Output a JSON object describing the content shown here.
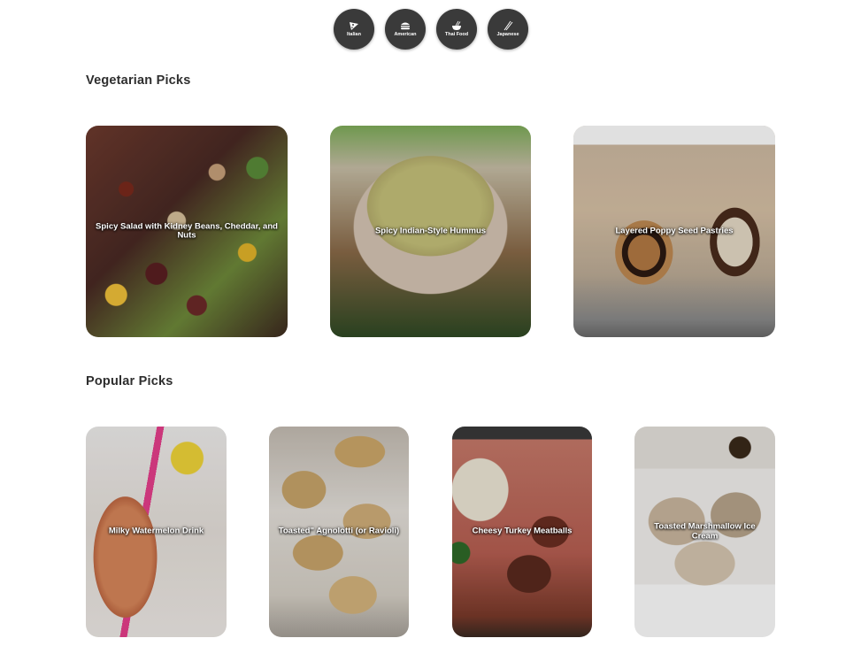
{
  "categories": [
    {
      "label": "Italian",
      "icon": "pizza-icon"
    },
    {
      "label": "American",
      "icon": "burger-icon"
    },
    {
      "label": "Thai Food",
      "icon": "noodle-bowl-icon"
    },
    {
      "label": "Japanese",
      "icon": "chopsticks-icon"
    }
  ],
  "sections": {
    "vegetarian": {
      "title": "Vegetarian Picks",
      "cards": [
        {
          "title": "Spicy Salad with Kidney Beans, Cheddar, and Nuts"
        },
        {
          "title": "Spicy Indian-Style Hummus"
        },
        {
          "title": "Layered Poppy Seed Pastries"
        }
      ]
    },
    "popular": {
      "title": "Popular Picks",
      "cards": [
        {
          "title": "Milky Watermelon Drink"
        },
        {
          "title": "Toasted\" Agnolotti (or Ravioli)"
        },
        {
          "title": "Cheesy Turkey Meatballs"
        },
        {
          "title": "Toasted Marshmallow Ice Cream"
        }
      ]
    }
  }
}
